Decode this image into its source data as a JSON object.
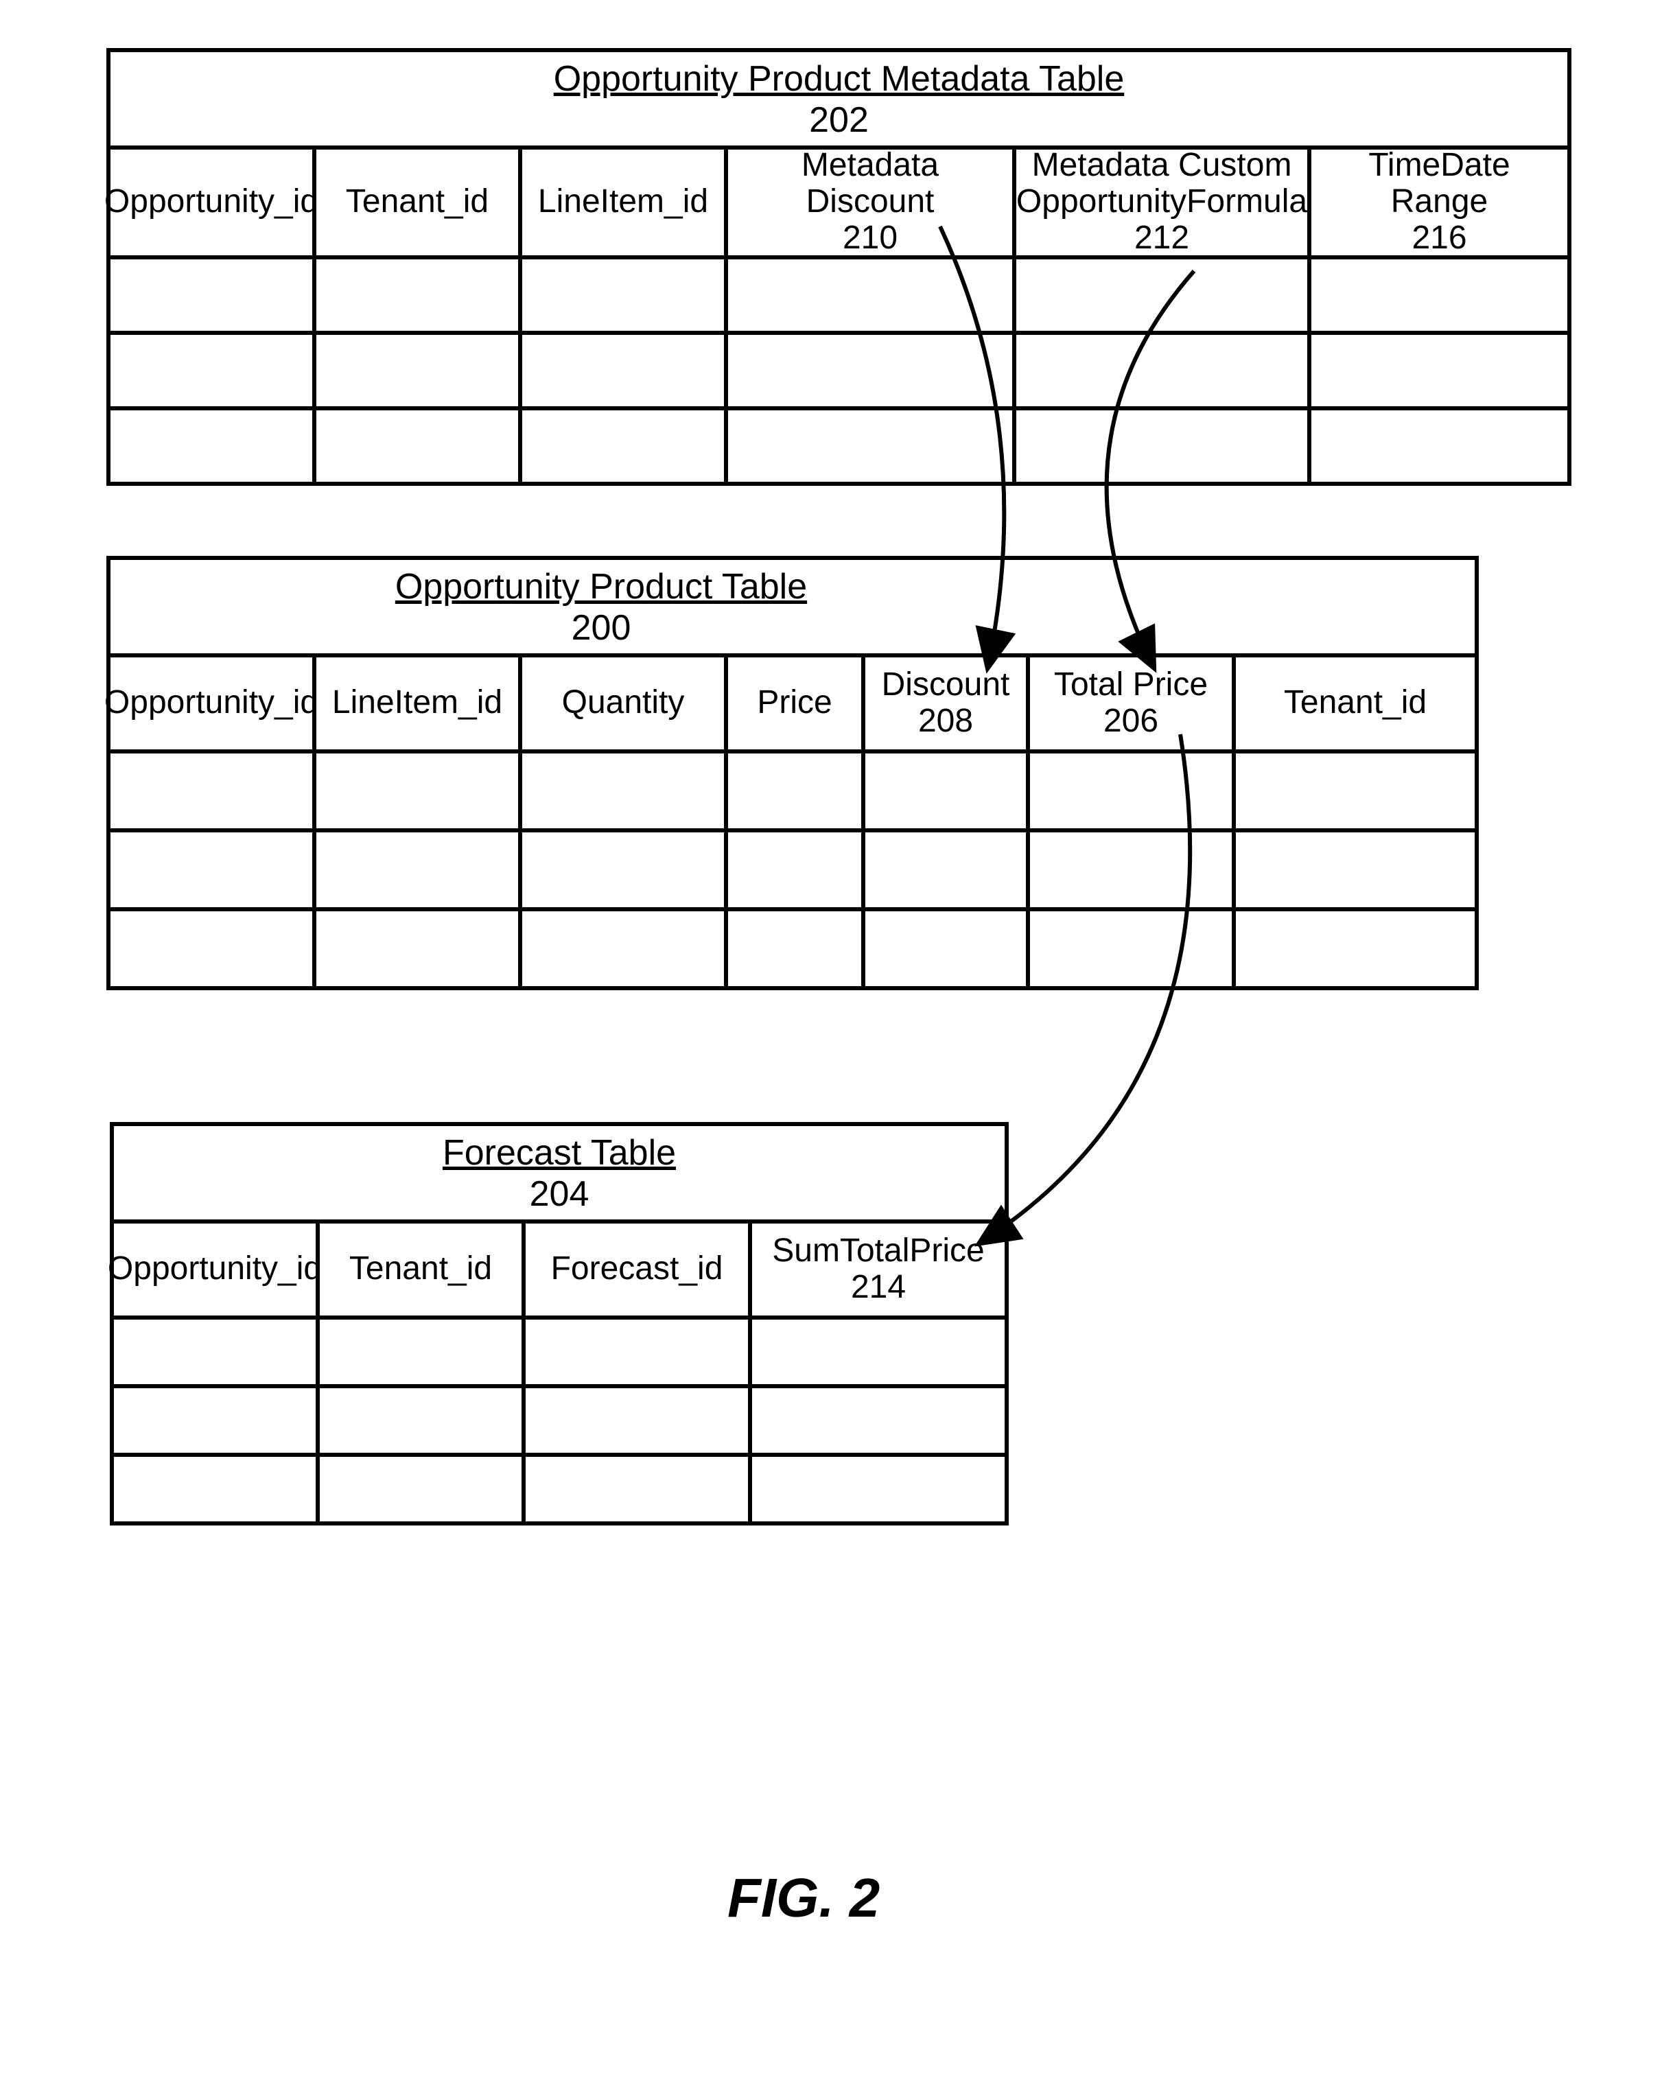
{
  "figure_label": "FIG. 2",
  "tables": {
    "metadata": {
      "title": "Opportunity Product Metadata Table",
      "ref": "202",
      "headers": [
        {
          "label": "Opportunity_id",
          "ref": ""
        },
        {
          "label": "Tenant_id",
          "ref": ""
        },
        {
          "label": "LineItem_id",
          "ref": ""
        },
        {
          "label": "Metadata Discount",
          "ref": "210"
        },
        {
          "label": "Metadata Custom OpportunityFormula",
          "ref": "212"
        },
        {
          "label": "TimeDate Range",
          "ref": "216"
        }
      ]
    },
    "product": {
      "title": "Opportunity Product Table",
      "ref": "200",
      "headers": [
        {
          "label": "Opportunity_id",
          "ref": ""
        },
        {
          "label": "LineItem_id",
          "ref": ""
        },
        {
          "label": "Quantity",
          "ref": ""
        },
        {
          "label": "Price",
          "ref": ""
        },
        {
          "label": "Discount",
          "ref": "208"
        },
        {
          "label": "Total Price",
          "ref": "206"
        },
        {
          "label": "Tenant_id",
          "ref": ""
        }
      ]
    },
    "forecast": {
      "title": "Forecast Table",
      "ref": "204",
      "headers": [
        {
          "label": "Opportunity_id",
          "ref": ""
        },
        {
          "label": "Tenant_id",
          "ref": ""
        },
        {
          "label": "Forecast_id",
          "ref": ""
        },
        {
          "label": "SumTotalPrice",
          "ref": "214"
        }
      ]
    }
  },
  "arrows": [
    {
      "from": "metadata.Metadata Discount(210)",
      "to": "product.Discount(208)"
    },
    {
      "from": "metadata.Metadata Custom OpportunityFormula(212)",
      "to": "product.Total Price(206)"
    },
    {
      "from": "product.Total Price(206)",
      "to": "forecast.SumTotalPrice(214)"
    }
  ]
}
